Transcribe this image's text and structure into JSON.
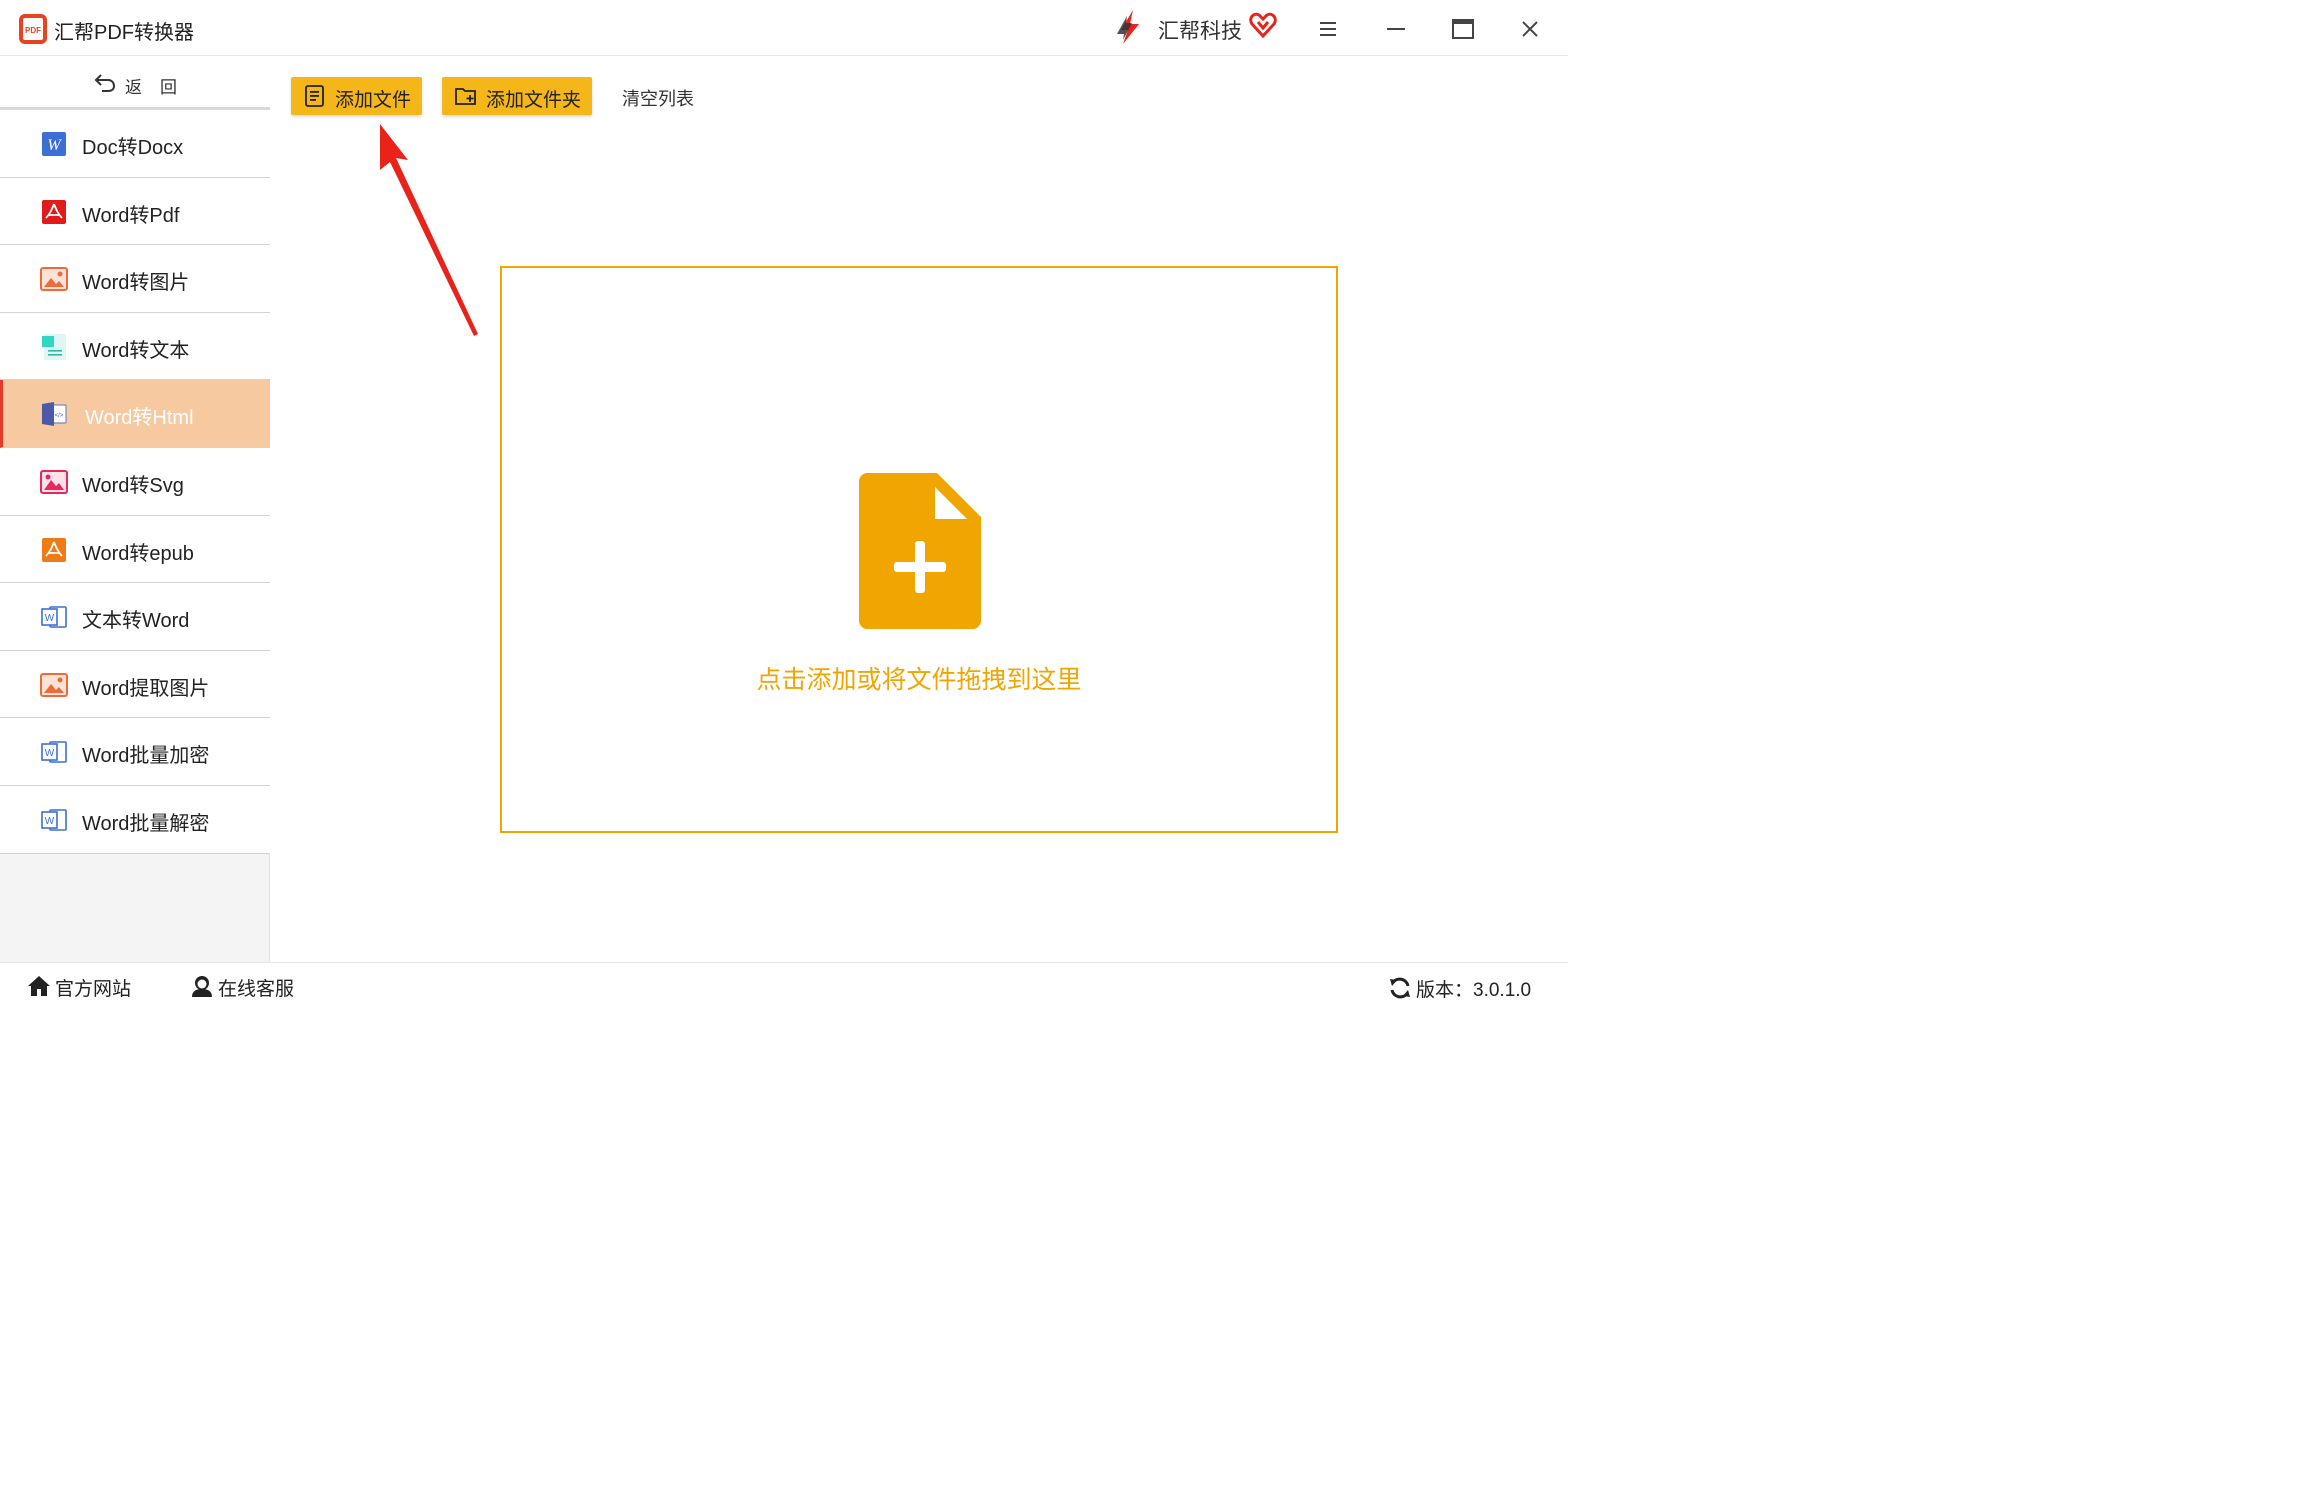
{
  "titlebar": {
    "app_title": "汇帮PDF转换器",
    "brand_name": "汇帮科技",
    "app_logo_text": "PDF",
    "icons": [
      "app-logo-icon",
      "brand-logo-icon",
      "vip-heart-icon",
      "menu-icon",
      "minimize-icon",
      "maximize-icon",
      "close-icon"
    ]
  },
  "sidebar": {
    "back_label": "返回",
    "items": [
      {
        "label": "Doc转Docx",
        "icon": "word-w-icon",
        "active": false
      },
      {
        "label": "Word转Pdf",
        "icon": "pdf-icon",
        "active": false
      },
      {
        "label": "Word转图片",
        "icon": "image-icon",
        "active": false
      },
      {
        "label": "Word转文本",
        "icon": "text-doc-icon",
        "active": false
      },
      {
        "label": "Word转Html",
        "icon": "html-icon",
        "active": true
      },
      {
        "label": "Word转Svg",
        "icon": "svg-image-icon",
        "active": false
      },
      {
        "label": "Word转epub",
        "icon": "epub-icon",
        "active": false
      },
      {
        "label": "文本转Word",
        "icon": "word-outline-icon",
        "active": false
      },
      {
        "label": "Word提取图片",
        "icon": "image-icon",
        "active": false
      },
      {
        "label": "Word批量加密",
        "icon": "word-outline-icon",
        "active": false
      },
      {
        "label": "Word批量解密",
        "icon": "word-outline-icon",
        "active": false
      }
    ]
  },
  "toolbar": {
    "add_file": "添加文件",
    "add_folder": "添加文件夹",
    "clear_list": "清空列表"
  },
  "dropzone": {
    "hint": "点击添加或将文件拖拽到这里",
    "icon": "file-add-icon"
  },
  "footer": {
    "website": "官方网站",
    "service": "在线客服",
    "version": "版本：3.0.1.0"
  },
  "colors": {
    "accent": "#f4b619",
    "dropzone_border": "#f0a500",
    "active_item_bg": "#f6c9a0",
    "active_marker": "#e63a28",
    "annotation_arrow": "#e8231a"
  }
}
